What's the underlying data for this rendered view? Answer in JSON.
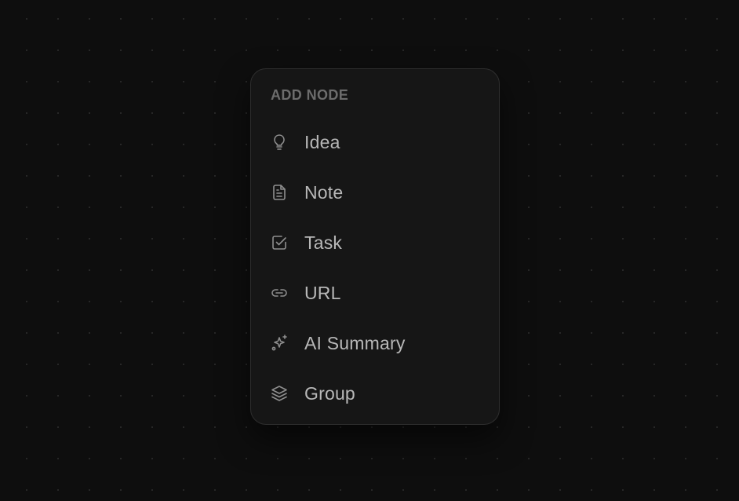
{
  "menu": {
    "title": "ADD NODE",
    "items": [
      {
        "label": "Idea",
        "icon": "lightbulb-icon"
      },
      {
        "label": "Note",
        "icon": "document-icon"
      },
      {
        "label": "Task",
        "icon": "checkbox-icon"
      },
      {
        "label": "URL",
        "icon": "link-icon"
      },
      {
        "label": "AI Summary",
        "icon": "sparkles-icon"
      },
      {
        "label": "Group",
        "icon": "layers-icon"
      }
    ]
  },
  "colors": {
    "background": "#0e0e0e",
    "panel": "#161616",
    "panel_border": "#2e2e2e",
    "title_text": "#6c6c6c",
    "item_text": "#b8b8b8",
    "icon_stroke": "#8e8e8e"
  }
}
